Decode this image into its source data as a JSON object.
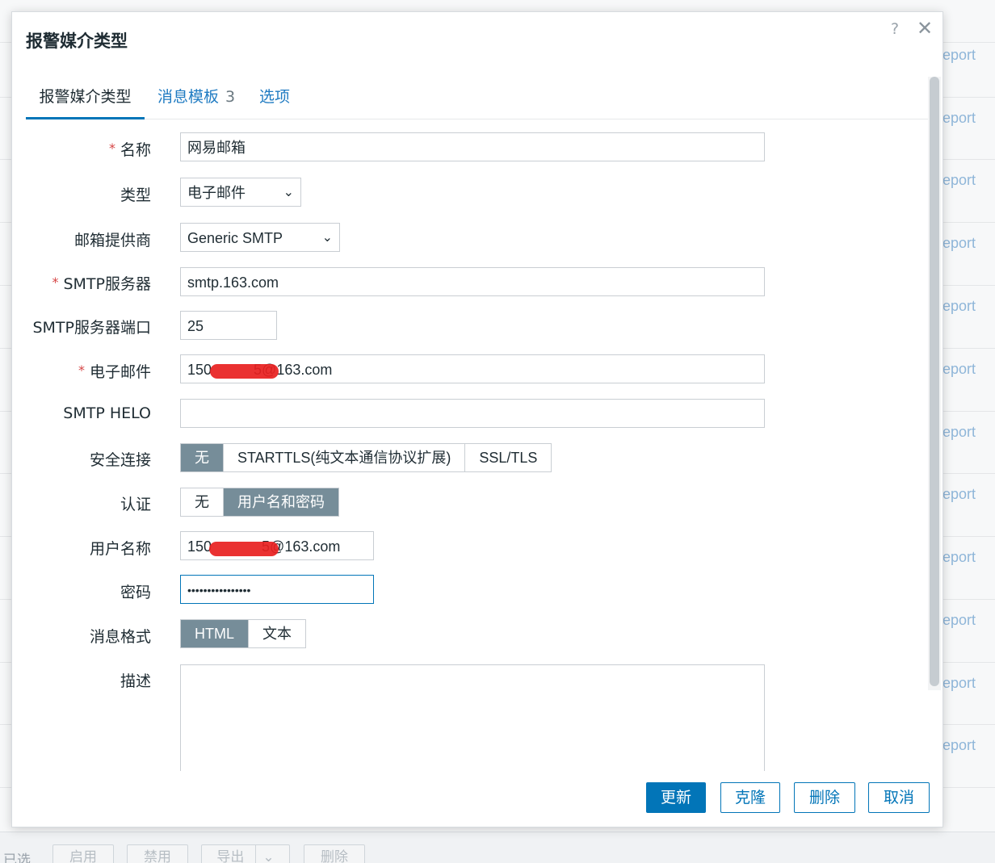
{
  "background": {
    "row_link_text": "eport",
    "footer": {
      "selected_label": "已选",
      "buttons": [
        "启用",
        "禁用",
        "导出",
        "删除"
      ]
    }
  },
  "modal": {
    "title": "报警媒介类型",
    "help": "?",
    "close": "✕",
    "tabs": [
      {
        "label": "报警媒介类型",
        "badge": ""
      },
      {
        "label": "消息模板",
        "badge": "3"
      },
      {
        "label": "选项",
        "badge": ""
      }
    ],
    "form": {
      "name": {
        "label": "名称",
        "value": "网易邮箱",
        "required": "*"
      },
      "type": {
        "label": "类型",
        "value": "电子邮件"
      },
      "provider": {
        "label": "邮箱提供商",
        "value": "Generic SMTP"
      },
      "smtp_server": {
        "label": "SMTP服务器",
        "value": "smtp.163.com",
        "required": "*"
      },
      "smtp_port": {
        "label": "SMTP服务器端口",
        "value": "25"
      },
      "email": {
        "label": "电子邮件",
        "value_prefix": "150",
        "value_suffix": "5@163.com",
        "required": "*"
      },
      "smtp_helo": {
        "label": "SMTP HELO",
        "value": ""
      },
      "security": {
        "label": "安全连接",
        "options": [
          "无",
          "STARTTLS(纯文本通信协议扩展)",
          "SSL/TLS"
        ],
        "selected": "无"
      },
      "auth": {
        "label": "认证",
        "options": [
          "无",
          "用户名和密码"
        ],
        "selected": "用户名和密码"
      },
      "username": {
        "label": "用户名称",
        "value_prefix": "150",
        "value_suffix": "5@163.com"
      },
      "password": {
        "label": "密码",
        "value": "••••••••••••••••"
      },
      "message_format": {
        "label": "消息格式",
        "options": [
          "HTML",
          "文本"
        ],
        "selected": "HTML"
      },
      "description": {
        "label": "描述",
        "value": ""
      }
    },
    "buttons": {
      "update": "更新",
      "clone": "克隆",
      "delete": "删除",
      "cancel": "取消"
    }
  }
}
